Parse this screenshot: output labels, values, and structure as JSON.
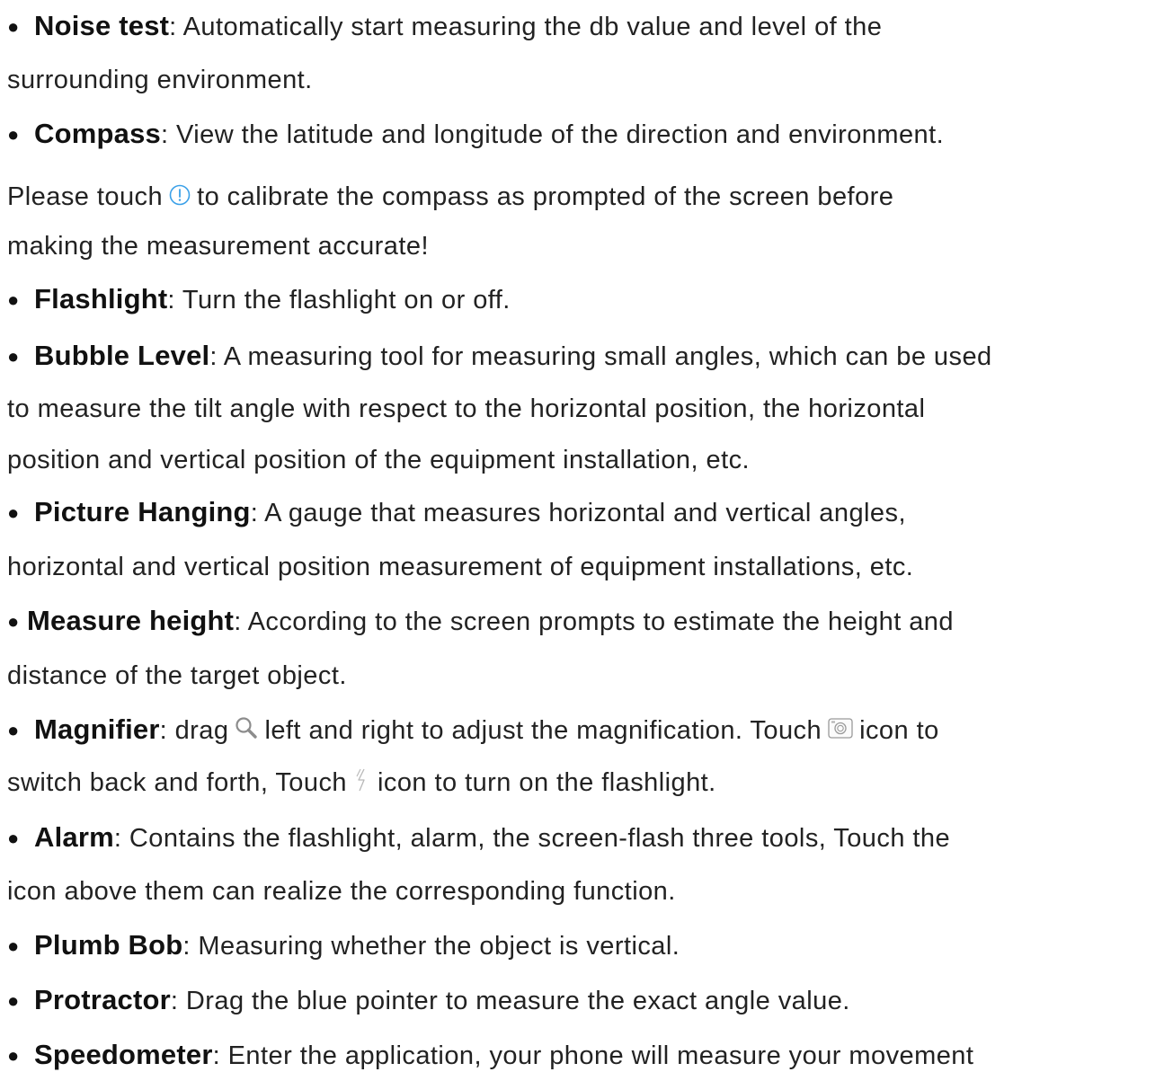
{
  "items": [
    {
      "term": "Noise test",
      "lines": [
        ": Automatically start measuring the db value and level of the",
        "surrounding environment."
      ]
    },
    {
      "term": "Compass",
      "lines": [
        ": View the latitude and longitude of the direction and environment.",
        "Please touch",
        "to calibrate the compass as prompted of the screen before",
        "making the measurement accurate!"
      ]
    },
    {
      "term": "Flashlight",
      "lines": [
        ": Turn the flashlight on or off."
      ]
    },
    {
      "term": "Bubble Level",
      "lines": [
        ": A measuring tool for measuring small angles, which can be used",
        "to measure the tilt angle with respect to the horizontal position, the horizontal",
        "position and vertical position of the equipment installation, etc."
      ]
    },
    {
      "term": "Picture Hanging",
      "lines": [
        ": A gauge that measures horizontal and vertical angles,",
        "horizontal and vertical position measurement of equipment installations, etc."
      ]
    },
    {
      "term": "Measure height",
      "lines": [
        ": According to the screen prompts to estimate the height and",
        "distance of the target object."
      ]
    },
    {
      "term": "Magnifier",
      "lines": [
        ": drag",
        "left and right to adjust the magnification. Touch",
        "icon to",
        "switch back and forth, Touch",
        "icon to turn on the flashlight."
      ]
    },
    {
      "term": "Alarm",
      "lines": [
        ": Contains the flashlight, alarm, the screen-flash three tools, Touch the",
        "icon above them can realize the corresponding function."
      ]
    },
    {
      "term": "Plumb Bob",
      "lines": [
        ": Measuring whether the object is vertical."
      ]
    },
    {
      "term": "Protractor",
      "lines": [
        ": Drag the blue pointer to measure the exact angle value."
      ]
    },
    {
      "term": "Speedometer",
      "lines": [
        ": Enter the application, your phone will measure your movement"
      ]
    }
  ],
  "bullet": "●",
  "icons": {
    "calibrate": "info-circle-icon",
    "magnifier": "search-icon",
    "camera": "camera-switch-icon",
    "flash": "flash-icon"
  },
  "colors": {
    "text": "#222222",
    "calibrate_icon": "#3aa0e8",
    "gray_icon": "#9a9a9a"
  }
}
